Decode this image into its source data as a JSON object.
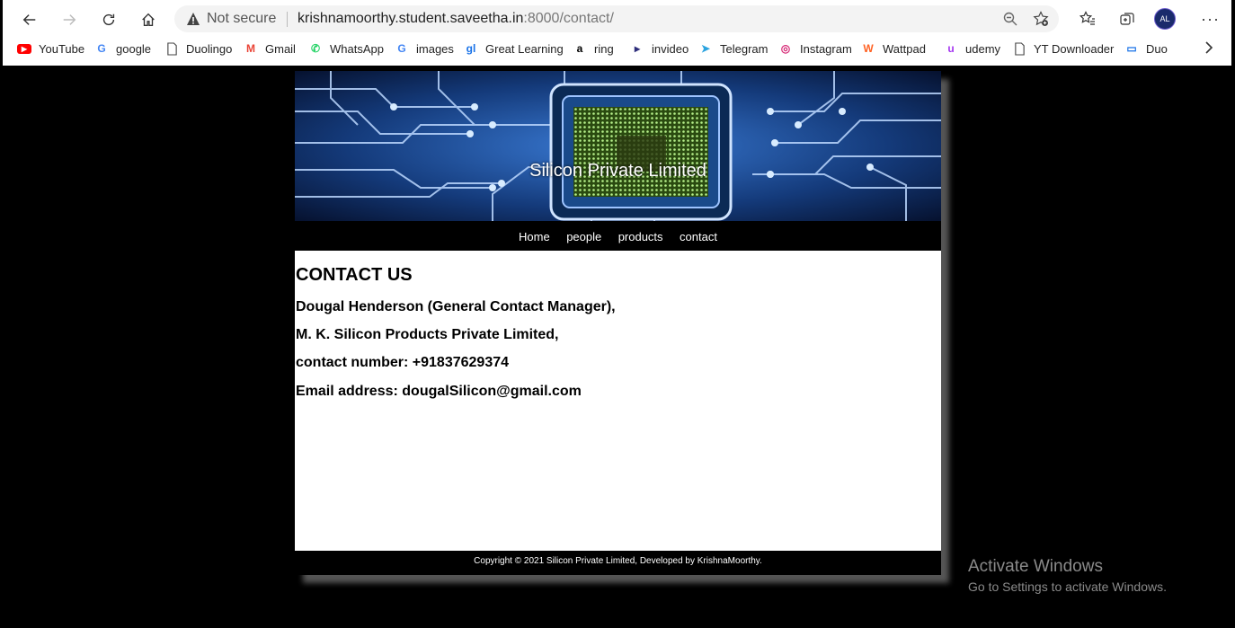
{
  "browser": {
    "not_secure": "Not secure",
    "url_host": "krishnamoorthy.student.saveetha.in",
    "url_rest": ":8000/contact/",
    "profile_initials": "AL",
    "more_label": "···"
  },
  "bookmarks": [
    {
      "label": "YouTube",
      "icon": "youtube-icon",
      "color": "#ff0000"
    },
    {
      "label": "google",
      "icon": "google-icon",
      "color": "#4285f4"
    },
    {
      "label": "Duolingo",
      "icon": "page-icon",
      "color": "#555555"
    },
    {
      "label": "Gmail",
      "icon": "gmail-icon",
      "color": "#ea4335"
    },
    {
      "label": "WhatsApp",
      "icon": "whatsapp-icon",
      "color": "#25d366"
    },
    {
      "label": "images",
      "icon": "google-icon",
      "color": "#4285f4"
    },
    {
      "label": "Great Learning",
      "icon": "greatlearning-icon",
      "color": "#1a73e8"
    },
    {
      "label": "ring",
      "icon": "amazon-icon",
      "color": "#000000"
    },
    {
      "label": "invideo",
      "icon": "invideo-icon",
      "color": "#2d2d7a"
    },
    {
      "label": "Telegram",
      "icon": "telegram-icon",
      "color": "#2aa3df"
    },
    {
      "label": "Instagram",
      "icon": "instagram-icon",
      "color": "#d62976"
    },
    {
      "label": "Wattpad",
      "icon": "wattpad-icon",
      "color": "#ff6122"
    },
    {
      "label": "udemy",
      "icon": "udemy-icon",
      "color": "#a435f0"
    },
    {
      "label": "YT Downloader",
      "icon": "page-icon",
      "color": "#555555"
    },
    {
      "label": "Duo",
      "icon": "duo-icon",
      "color": "#1a73e8"
    }
  ],
  "site": {
    "title": "Silicon Private Limited",
    "menu": [
      "Home",
      "people",
      "products",
      "contact"
    ],
    "heading": "CONTACT US",
    "lines": [
      "Dougal Henderson (General Contact Manager),",
      "M. K. Silicon Products Private Limited,",
      "contact number: +91837629374",
      "Email address: dougalSilicon@gmail.com"
    ],
    "footer": "Copyright © 2021 Silicon Private Limited, Developed by KrishnaMoorthy."
  },
  "watermark": {
    "title": "Activate Windows",
    "subtitle": "Go to Settings to activate Windows."
  }
}
